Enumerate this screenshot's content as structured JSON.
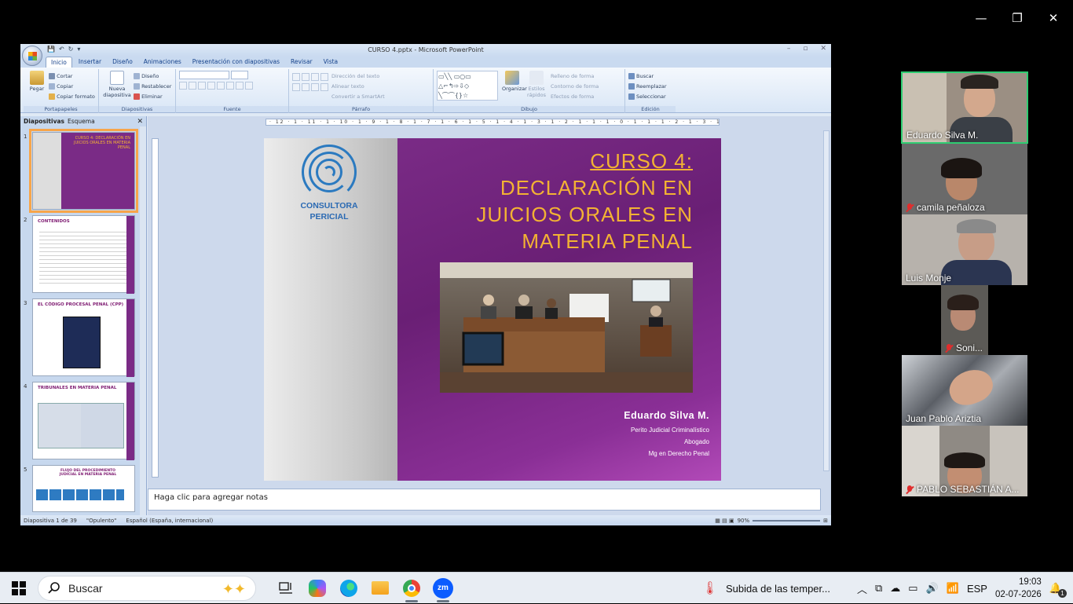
{
  "ppt": {
    "window_title": "CURSO 4.pptx - Microsoft PowerPoint",
    "tabs": [
      "Inicio",
      "Insertar",
      "Diseño",
      "Animaciones",
      "Presentación con diapositivas",
      "Revisar",
      "Vista"
    ],
    "ribbon": {
      "portapapeles": {
        "pegar": "Pegar",
        "cortar": "Cortar",
        "copiar": "Copiar",
        "copiar_formato": "Copiar formato",
        "group": "Portapapeles"
      },
      "diapositivas": {
        "nueva": "Nueva",
        "diapositiva": "diapositiva",
        "diseno": "Diseño",
        "restablecer": "Restablecer",
        "eliminar": "Eliminar",
        "group": "Diapositivas"
      },
      "fuente": {
        "group": "Fuente"
      },
      "parrafo": {
        "direccion": "Dirección del texto",
        "alinear": "Alinear texto",
        "convertir": "Convertir a SmartArt",
        "group": "Párrafo"
      },
      "dibujo": {
        "organizar": "Organizar",
        "estilos": "Estilos",
        "rapidos": "rápidos",
        "relleno": "Relleno de forma",
        "contorno": "Contorno de forma",
        "efectos": "Efectos de forma",
        "group": "Dibujo"
      },
      "edicion": {
        "buscar": "Buscar",
        "reemplazar": "Reemplazar",
        "seleccionar": "Seleccionar",
        "group": "Edición"
      }
    },
    "pane_tabs": {
      "slides": "Diapositivas",
      "outline": "Esquema"
    },
    "thumbs": [
      {
        "num": "1",
        "title": "CURSO 4: DECLARACIÓN EN JUICIOS ORALES EN MATERIA PENAL"
      },
      {
        "num": "2",
        "title": "CONTENIDOS"
      },
      {
        "num": "3",
        "title": "EL CÓDIGO PROCESAL PENAL (CPP)"
      },
      {
        "num": "4",
        "title": "TRIBUNALES EN MATERIA PENAL"
      },
      {
        "num": "5",
        "title": "FLUJO DEL PROCEDIMIENTO JUDICIAL EN MATERIA PENAL"
      }
    ],
    "ruler": "· 12 · 1 · 11 · 1 · 10 · 1 · 9 · 1 · 8 · 1 · 7 · 1 · 6 · 1 · 5 · 1 · 4 · 1 · 3 · 1 · 2 · 1 · 1 · 1 · 0 · 1 · 1 · 1 · 2 · 1 · 3 · 1 · 4 · 1 · 5 · 1 · 6 · 1 · 7 · 1 · 8 · 1 · 9 · 1 · 10 · 1 · 11 · 1 · 12 ·",
    "slide": {
      "logo_line1": "CONSULTORA",
      "logo_line2": "PERICIAL",
      "title_line1": "CURSO 4:",
      "title_line2": "DECLARACIÓN EN",
      "title_line3": "JUICIOS ORALES EN",
      "title_line4": "MATERIA PENAL",
      "author": "Eduardo Silva M.",
      "role1": "Perito Judicial Criminalístico",
      "role2": "Abogado",
      "role3": "Mg en Derecho Penal"
    },
    "notes_placeholder": "Haga clic para agregar notas",
    "status": {
      "slide": "Diapositiva 1 de 39",
      "theme": "\"Opulento\"",
      "lang": "Español (España, internacional)",
      "zoom": "90%"
    }
  },
  "participants": [
    {
      "name": "Eduardo Silva M.",
      "muted": false,
      "active_speaker": true
    },
    {
      "name": "camila peñaloza",
      "muted": true
    },
    {
      "name": "Luis Monje",
      "muted": false
    },
    {
      "name": "Soni...",
      "muted": true
    },
    {
      "name": "Juan Pablo Ariztia",
      "muted": false
    },
    {
      "name": "PABLO SEBASTIÁN A...",
      "muted": true
    }
  ],
  "taskbar": {
    "search_label": "Buscar",
    "weather": "Subida de las temper...",
    "lang": "ESP",
    "time": "19:03",
    "date": "02-07-2026",
    "notif_count": "1"
  },
  "colors": {
    "slide_purple": "#7a2b86",
    "title_gold": "#f3b233",
    "logo_blue": "#2b6ab3",
    "active_speaker": "#2ecc71"
  }
}
